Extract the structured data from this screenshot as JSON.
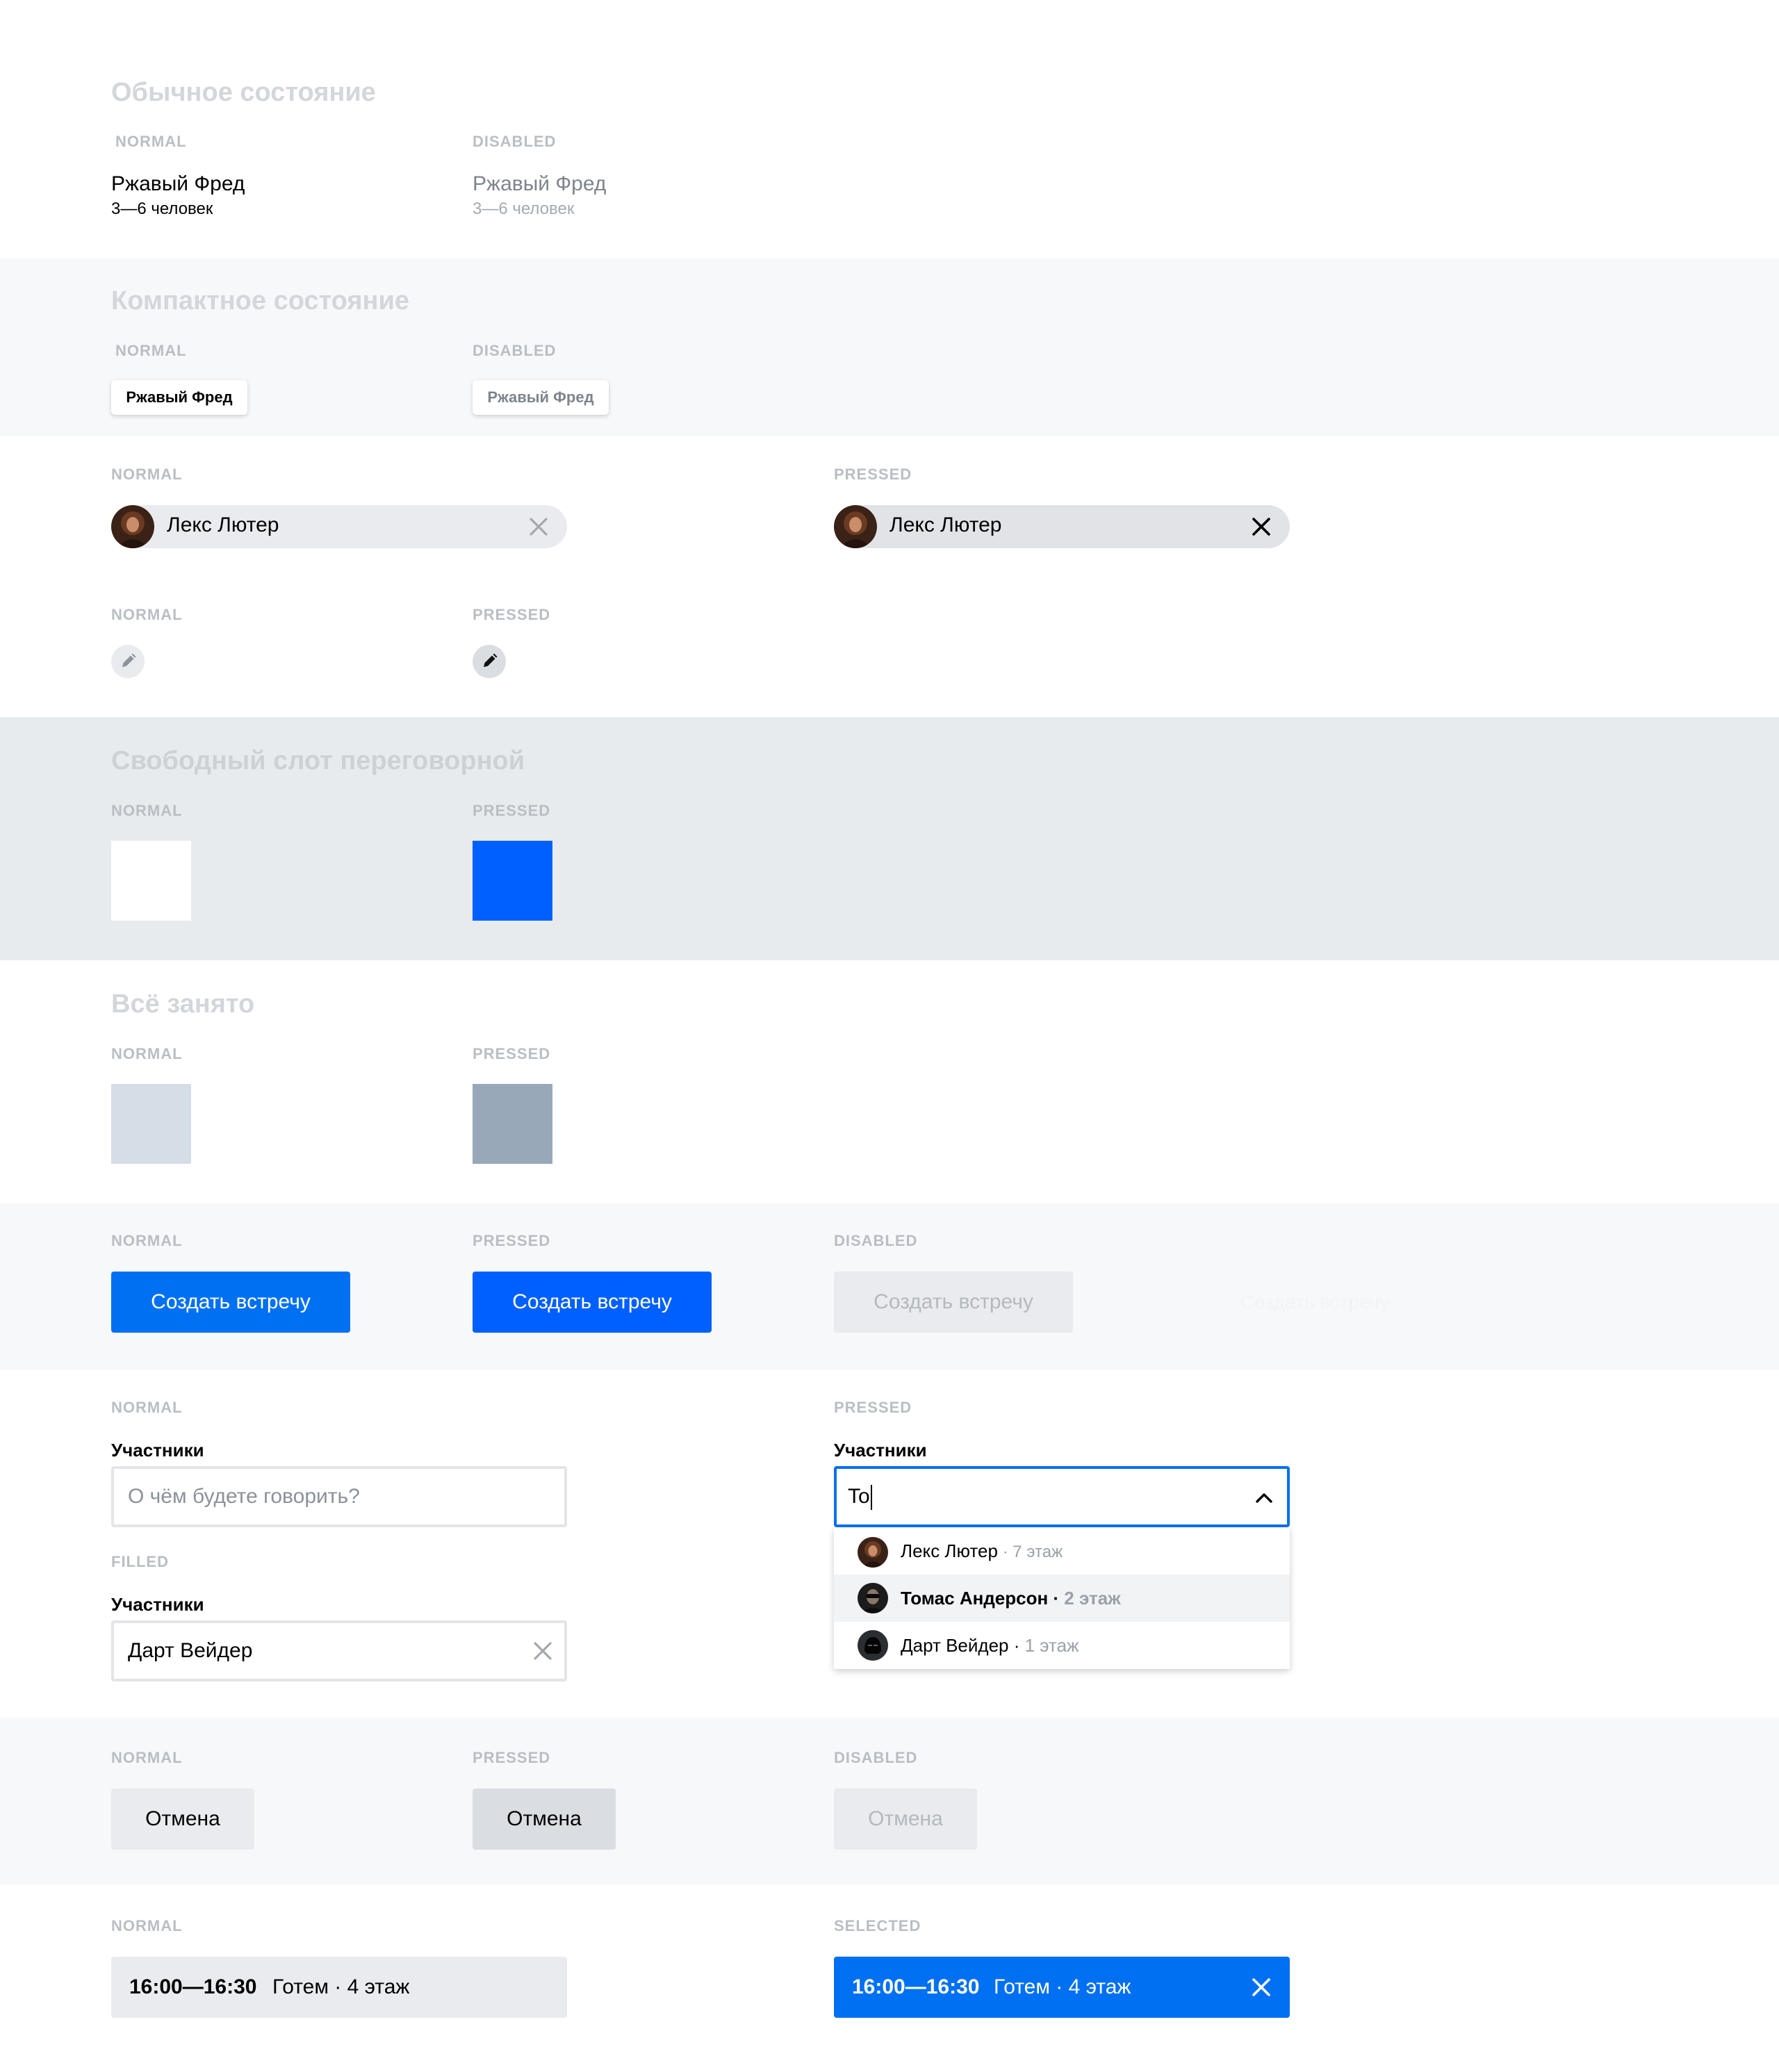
{
  "colors": {
    "accent": "#0070f3",
    "accent_pressed": "#0060ff",
    "title_gray": "#d3d6da",
    "label_gray": "#b9bec4",
    "chip_gray": "#e9ebee",
    "busy_normal": "#d5dde6",
    "busy_pressed": "#98a8b8"
  },
  "section1": {
    "title": "Обычное состояние",
    "normal_label": "NORMAL",
    "disabled_label": "DISABLED",
    "normal_name": "Ржавый Фред",
    "normal_capacity": "3—6 человек",
    "disabled_name": "Ржавый Фред",
    "disabled_capacity": "3—6 человек"
  },
  "section2": {
    "title": "Компактное состояние",
    "normal_label": "NORMAL",
    "disabled_label": "DISABLED",
    "normal_chip": "Ржавый Фред",
    "disabled_chip": "Ржавый Фред"
  },
  "person_chips": {
    "normal_label": "NORMAL",
    "pressed_label": "PRESSED",
    "normal_name": "Лекс Лютер",
    "pressed_name": "Лекс Лютер",
    "avatar_icon": "avatar-photo",
    "remove_icon": "close-icon"
  },
  "edit_buttons": {
    "normal_label": "NORMAL",
    "pressed_label": "PRESSED",
    "icon": "pencil-icon"
  },
  "free_slot": {
    "title": "Свободный слот переговорной",
    "normal_label": "NORMAL",
    "pressed_label": "PRESSED"
  },
  "busy_slot": {
    "title": "Всё занято",
    "normal_label": "NORMAL",
    "pressed_label": "PRESSED"
  },
  "primary_buttons": {
    "normal_label": "NORMAL",
    "pressed_label": "PRESSED",
    "disabled_label": "DISABLED",
    "normal_text": "Создать встречу",
    "pressed_text": "Создать встречу",
    "disabled_text": "Создать встречу",
    "ghost_text": "Создать встречу"
  },
  "participants": {
    "normal_label": "NORMAL",
    "filled_label": "FILLED",
    "pressed_label": "PRESSED",
    "field_label_normal": "Участники",
    "field_label_filled": "Участники",
    "field_label_pressed": "Участники",
    "placeholder": "О чём будете говорить?",
    "filled_value": "Дарт Вейдер",
    "pressed_value": "To",
    "options": [
      {
        "name": "Лекс Лютер",
        "floor": " · 7 этаж"
      },
      {
        "name": "Томас Андерсон · ",
        "floor": "2 этаж"
      },
      {
        "name": "Дарт Вейдер · ",
        "floor": "1 этаж"
      }
    ]
  },
  "cancel_buttons": {
    "normal_label": "NORMAL",
    "pressed_label": "PRESSED",
    "disabled_label": "DISABLED",
    "normal_text": "Отмена",
    "pressed_text": "Отмена",
    "disabled_text": "Отмена"
  },
  "slot_chips": {
    "normal_label": "NORMAL",
    "selected_label": "SELECTED",
    "normal_time": "16:00—16:30",
    "normal_room": "Готем · 4 этаж",
    "selected_time": "16:00—16:30",
    "selected_room": "Готем · 4 этаж"
  }
}
